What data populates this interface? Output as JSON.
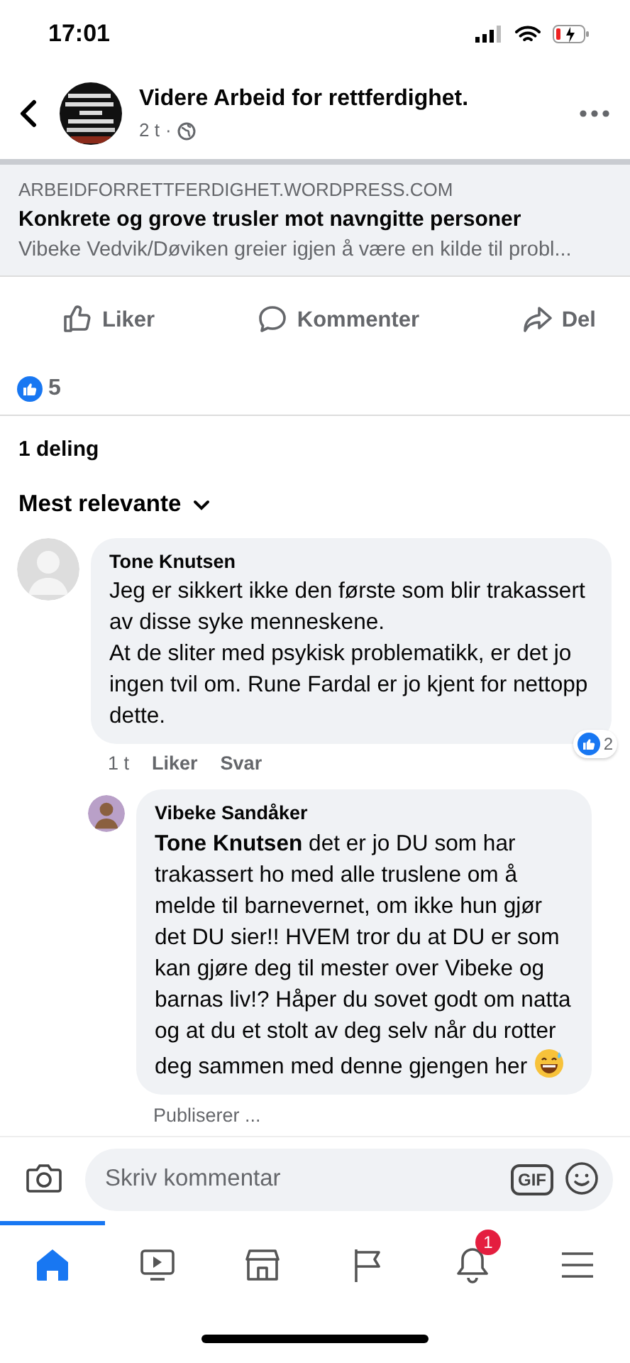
{
  "status_bar": {
    "time": "17:01"
  },
  "post_header": {
    "page_name": "Videre Arbeid for rettferdighet.",
    "time": "2 t",
    "separator": "·"
  },
  "link_preview": {
    "domain": "ARBEIDFORRETTFERDIGHET.WORDPRESS.COM",
    "title": "Konkrete og grove trusler mot navngitte personer",
    "description": "Vibeke Vedvik/Døviken greier igjen å være en kilde til probl..."
  },
  "actions": [
    {
      "kind": "like",
      "label": "Liker"
    },
    {
      "kind": "comment",
      "label": "Kommenter"
    },
    {
      "kind": "share",
      "label": "Del"
    }
  ],
  "reactions": {
    "count": "5"
  },
  "shares": "1 deling",
  "sort": {
    "label": "Mest relevante"
  },
  "comments": [
    {
      "author": "Tone Knutsen",
      "text": "Jeg er sikkert ikke den første som blir trakassert av disse syke menneskene.\nAt de sliter med psykisk problematikk, er det jo ingen tvil om. Rune Fardal er jo kjent for nettopp dette.",
      "time": "1 t",
      "actions": [
        "Liker",
        "Svar"
      ],
      "reaction_count": "2",
      "replies": [
        {
          "author": "Vibeke Sandåker",
          "text": "**Tone Knutsen** det er jo DU som har trakassert ho med alle truslene om å melde til barnevernet, om ikke hun gjør det DU sier!! HVEM tror du at DU er som kan gjøre deg til mester over Vibeke og barnas liv!? Håper du sovet godt om natta og at du et stolt av deg selv når du rotter deg sammen med denne gjengen her",
          "status": "Publiserer ..."
        }
      ]
    }
  ],
  "composer": {
    "placeholder": "Skriv kommentar",
    "gif": "GIF"
  },
  "tabs": [
    {
      "kind": "home",
      "selected": true
    },
    {
      "kind": "video",
      "selected": false
    },
    {
      "kind": "marketplace",
      "selected": false
    },
    {
      "kind": "pages",
      "selected": false
    },
    {
      "kind": "notifications",
      "selected": false,
      "badge": "1"
    },
    {
      "kind": "menu",
      "selected": false
    }
  ]
}
